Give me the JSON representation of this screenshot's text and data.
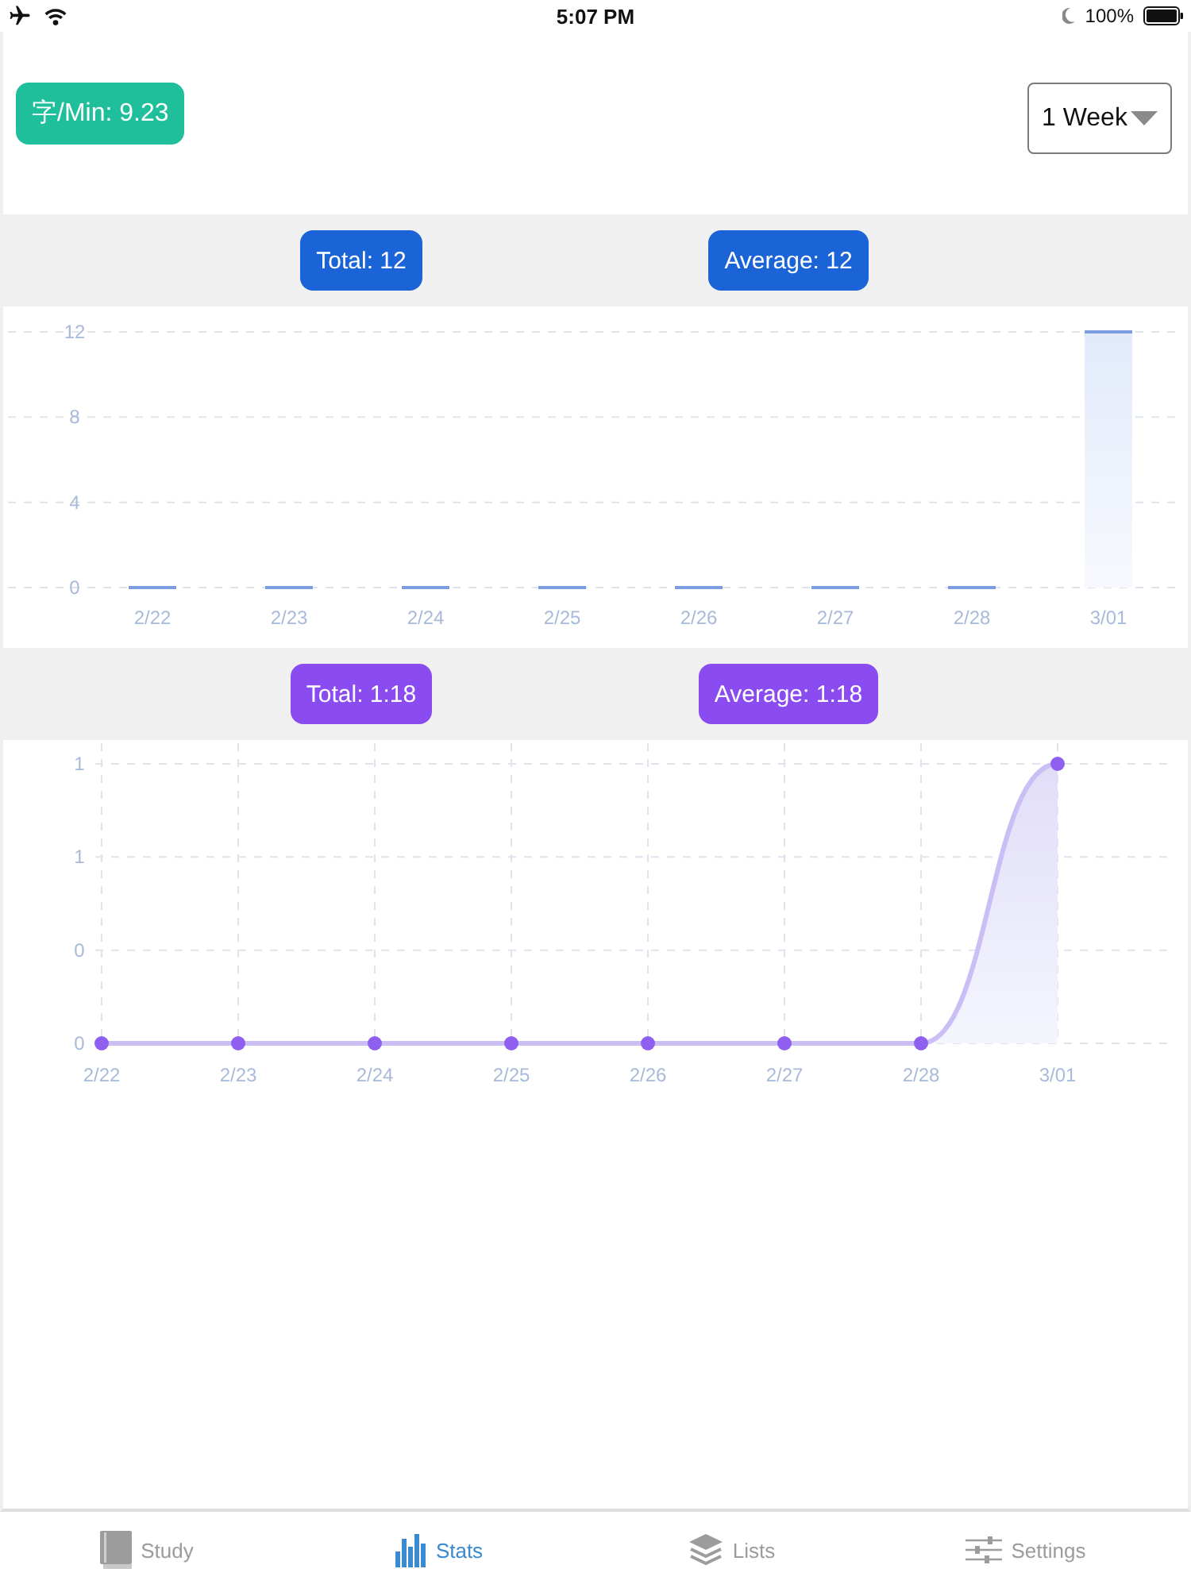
{
  "status_bar": {
    "time": "5:07 PM",
    "battery": "100%"
  },
  "header": {
    "speed_badge": "字/Min: 9.23",
    "range_dropdown": {
      "value": "1 Week"
    }
  },
  "panels": [
    {
      "color": "#1a64d8",
      "stats": [
        "Total: 12",
        "Average: 12"
      ],
      "chart_data": {
        "type": "bar",
        "categories": [
          "2/22",
          "2/23",
          "2/24",
          "2/25",
          "2/26",
          "2/27",
          "2/28",
          "3/01"
        ],
        "values": [
          0,
          0,
          0,
          0,
          0,
          0,
          0,
          12
        ],
        "ylim": [
          0,
          12
        ],
        "yticks": [
          0,
          4,
          8,
          12
        ],
        "grid": true
      }
    },
    {
      "color": "#8a4cf0",
      "stats": [
        "Total: 1:18",
        "Average: 1:18"
      ],
      "chart_data": {
        "type": "area",
        "categories": [
          "2/22",
          "2/23",
          "2/24",
          "2/25",
          "2/26",
          "2/27",
          "2/28",
          "3/01"
        ],
        "values": [
          0,
          0,
          0,
          0,
          0,
          0,
          0,
          1.3
        ],
        "ylim": [
          0,
          1.3
        ],
        "yticks": [
          {
            "value": 0,
            "label": "0"
          },
          {
            "value": 0.433,
            "label": "0"
          },
          {
            "value": 0.867,
            "label": "1"
          },
          {
            "value": 1.3,
            "label": "1"
          }
        ],
        "grid": true
      }
    }
  ],
  "tab_bar": [
    {
      "label": "Study",
      "selected": false
    },
    {
      "label": "Stats",
      "selected": true
    },
    {
      "label": "Lists",
      "selected": false
    },
    {
      "label": "Settings",
      "selected": false
    }
  ]
}
